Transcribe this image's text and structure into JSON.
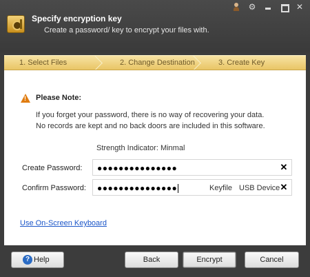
{
  "window": {
    "title": "Specify encryption key",
    "subtitle": "Create a password/ key to encrypt your files with."
  },
  "steps": [
    {
      "label": "1. Select Files"
    },
    {
      "label": "2. Change Destination"
    },
    {
      "label": "3. Create Key"
    }
  ],
  "note": {
    "title": "Please Note:",
    "line1": "If you forget your password, there is no way of recovering your data.",
    "line2": "No records are kept and no back doors are included in this software."
  },
  "strength": "Strength Indicator: Minmal",
  "create_password": {
    "label": "Create Password:",
    "value": "●●●●●●●●●●●●●●●"
  },
  "confirm_password": {
    "label": "Confirm Password:",
    "value": "●●●●●●●●●●●●●●●",
    "keyfile": "Keyfile",
    "usb": "USB Device"
  },
  "osk_link": "Use On-Screen Keyboard",
  "buttons": {
    "help": "Help",
    "back": "Back",
    "encrypt": "Encrypt",
    "cancel": "Cancel"
  }
}
